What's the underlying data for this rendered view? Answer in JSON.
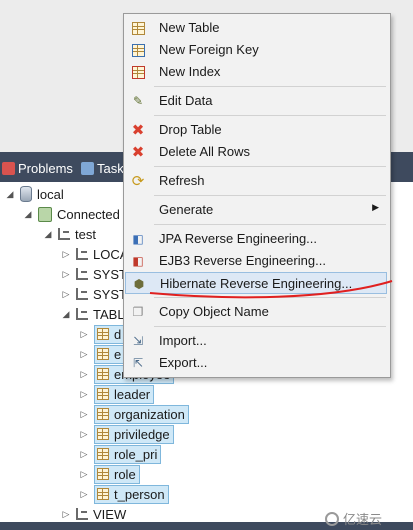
{
  "view_tabs": [
    {
      "label": "Problems",
      "icon": "problems-icon"
    },
    {
      "label": "Task",
      "icon": "tasks-icon"
    }
  ],
  "tree": {
    "local": "local",
    "connected": "Connected",
    "test": "test",
    "loca": "LOCA",
    "syst1": "SYST",
    "syst2": "SYST",
    "tabl": "TABL",
    "tables": [
      "d",
      "e",
      "employee",
      "leader",
      "organization",
      "priviledge",
      "role_pri",
      "role",
      "t_person"
    ],
    "view": "VIEW"
  },
  "menu": {
    "new_table": "New Table",
    "new_foreign_key": "New Foreign Key",
    "new_index": "New Index",
    "edit_data": "Edit Data",
    "drop_table": "Drop Table",
    "delete_all_rows": "Delete All Rows",
    "refresh": "Refresh",
    "generate": "Generate",
    "jpa_reverse": "JPA Reverse Engineering...",
    "ejb3_reverse": "EJB3 Reverse Engineering...",
    "hibernate_reverse": "Hibernate Reverse Engineering...",
    "copy_object_name": "Copy Object Name",
    "import": "Import...",
    "export": "Export..."
  },
  "watermark": "亿速云",
  "colors": {
    "tabbar": "#3e4a5e",
    "selection": "#cfe8f7",
    "menu_bg": "#f2f2f2",
    "highlight": "#dde8f5",
    "annotation": "#e02020"
  }
}
